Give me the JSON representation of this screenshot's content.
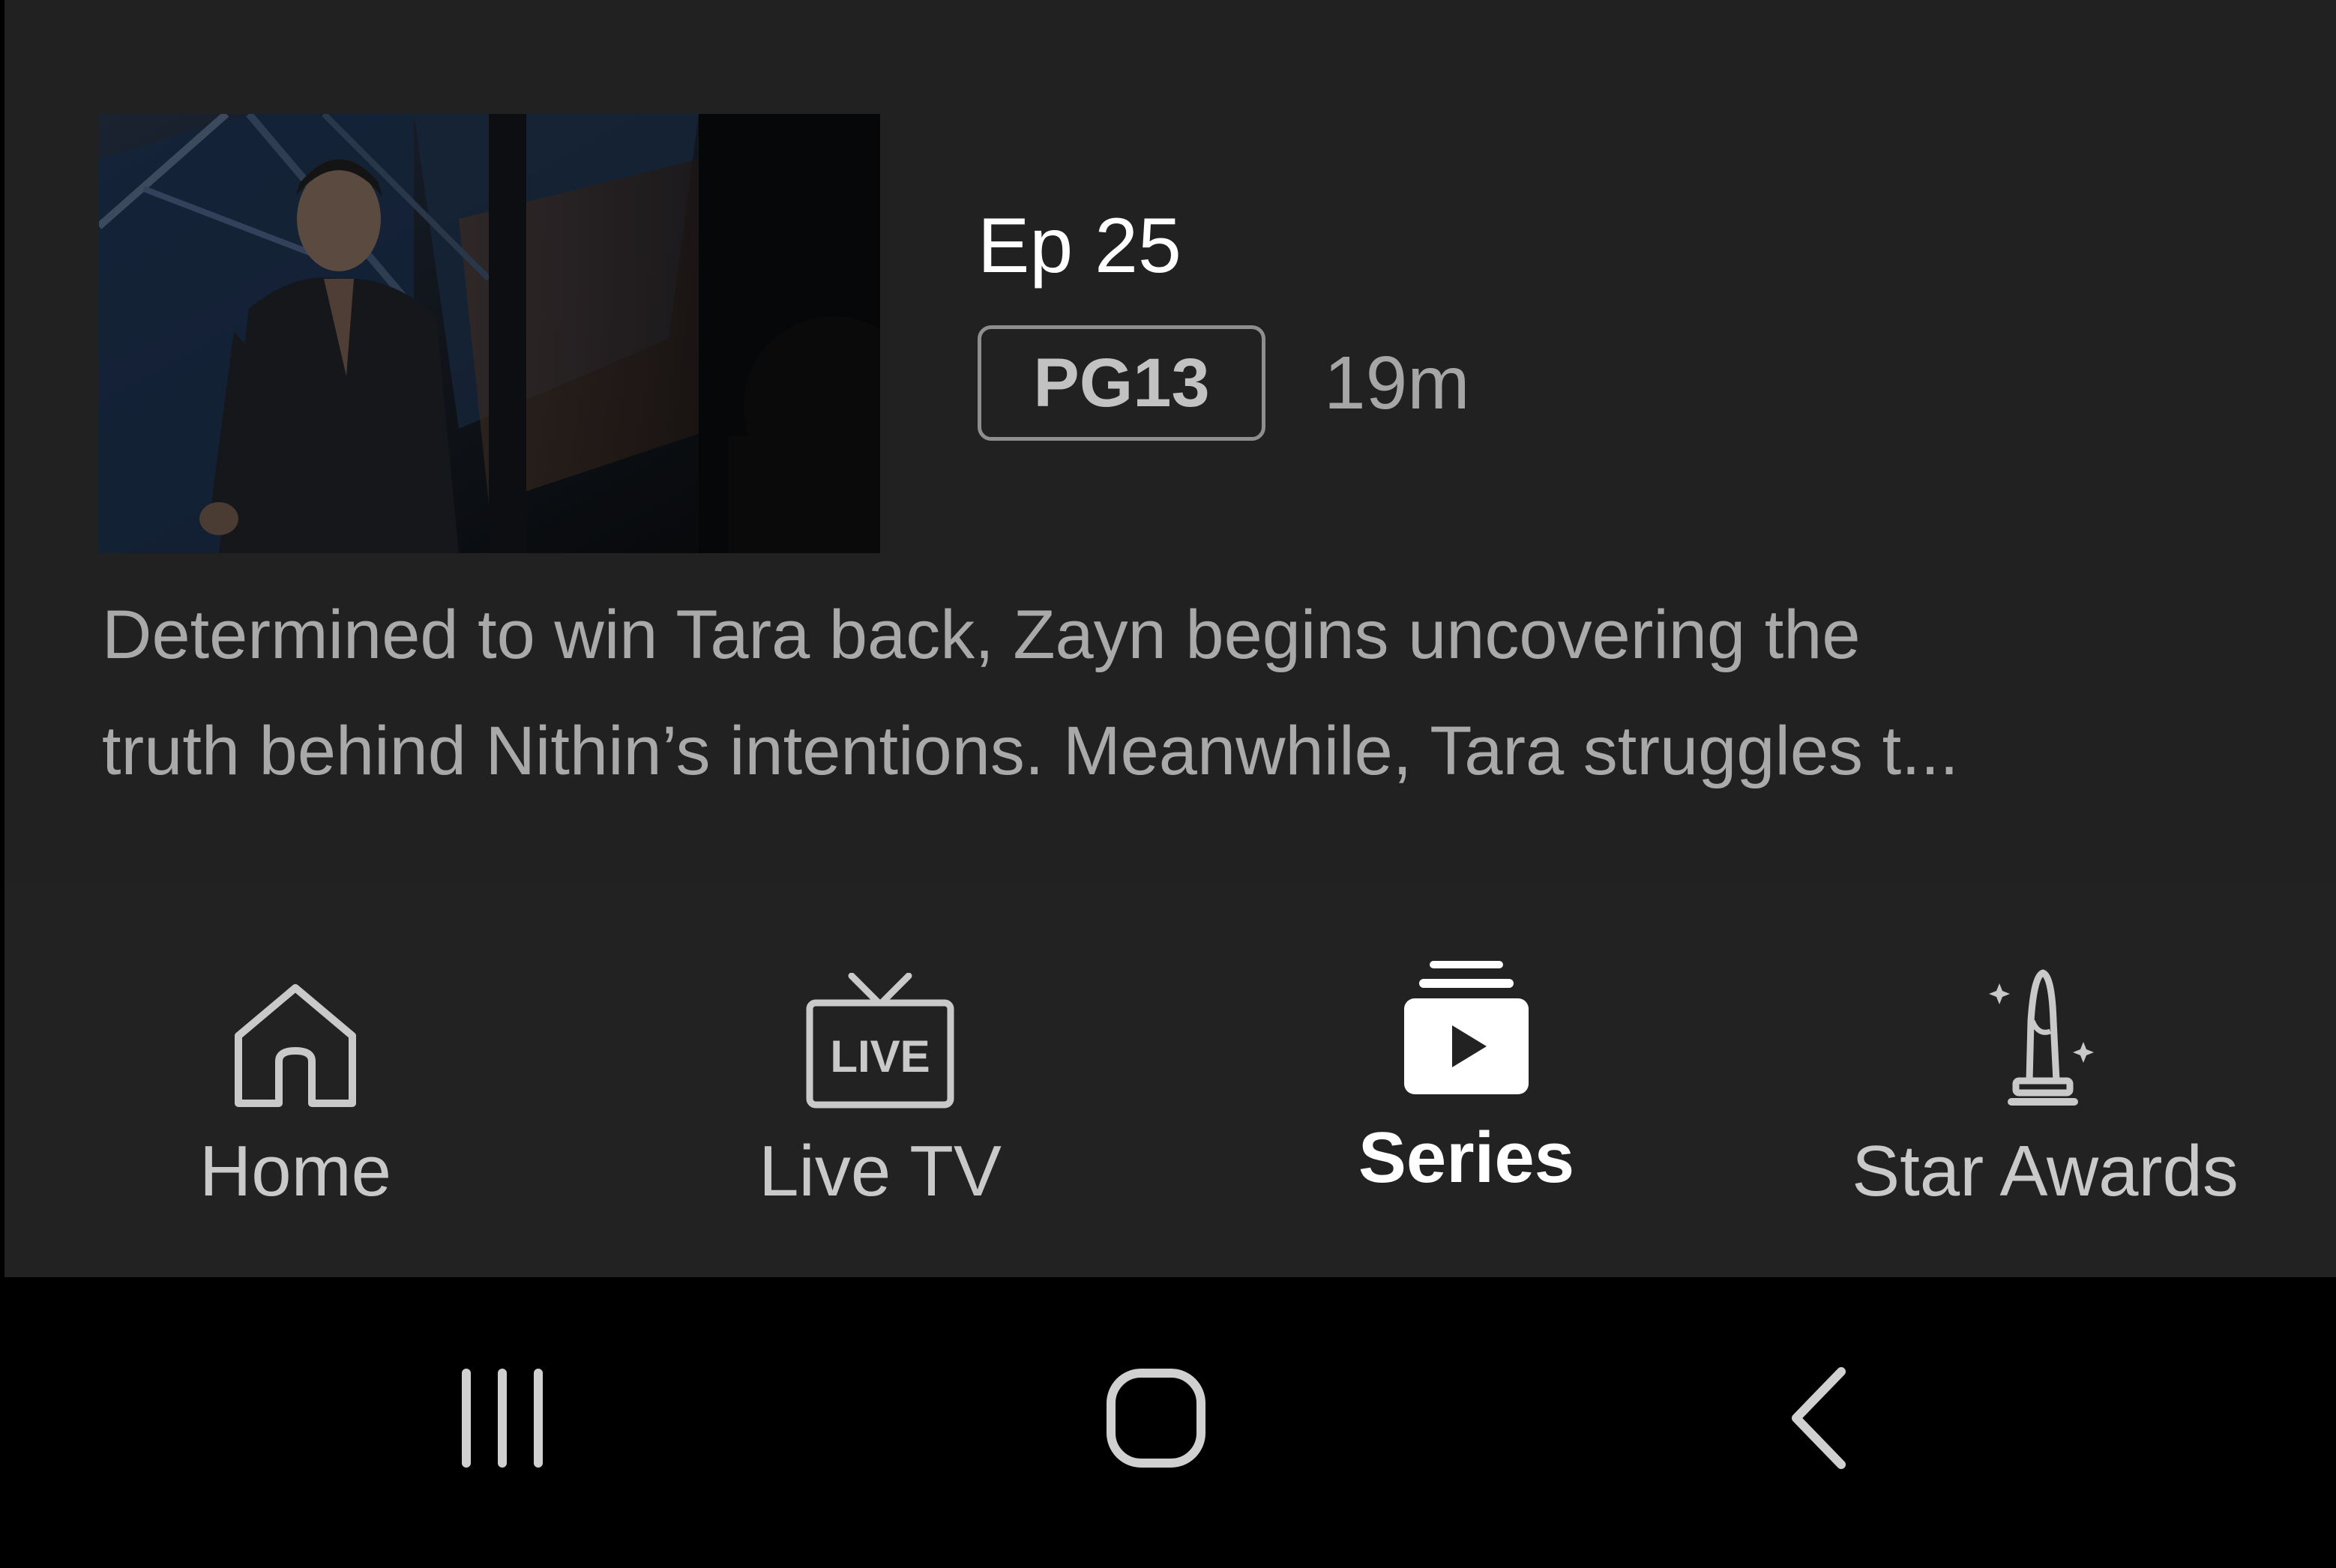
{
  "episode": {
    "title": "Ep 25",
    "rating": "PG13",
    "duration": "19m",
    "description_line1": "Determined to win Tara back, Zayn begins uncovering the",
    "description_line2": "truth behind Nithin’s intentions. Meanwhile, Tara struggles t..."
  },
  "nav": {
    "items": [
      {
        "label": "Home",
        "icon": "home-icon",
        "active": false
      },
      {
        "label": "Live TV",
        "icon": "live-tv-icon",
        "icon_text": "LIVE",
        "active": false
      },
      {
        "label": "Series",
        "icon": "series-icon",
        "active": true
      },
      {
        "label": "Star Awards",
        "icon": "star-awards-trophy-icon",
        "active": false
      }
    ]
  },
  "system_nav": {
    "buttons": [
      "recent-apps-icon",
      "home-circle-icon",
      "back-icon"
    ]
  },
  "colors": {
    "background": "#222222",
    "system_bar": "#000000",
    "text_primary": "#ffffff",
    "text_secondary": "#a9a9a9"
  }
}
